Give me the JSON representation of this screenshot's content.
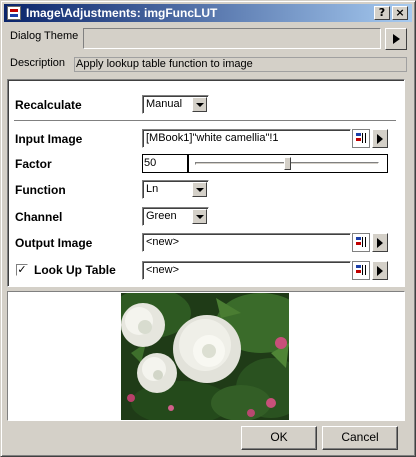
{
  "window": {
    "title": "Image\\Adjustments: imgFuncLUT",
    "help_label": "?",
    "close_label": "×"
  },
  "theme": {
    "label": "Dialog Theme",
    "value": ""
  },
  "description": {
    "label": "Description",
    "value": "Apply lookup table function to image"
  },
  "form": {
    "recalculate": {
      "label": "Recalculate",
      "value": "Manual"
    },
    "input_image": {
      "label": "Input Image",
      "value": "[MBook1]\"white camellia\"!1"
    },
    "factor": {
      "label": "Factor",
      "value": "50",
      "slider_fraction": 0.5
    },
    "function": {
      "label": "Function",
      "value": "Ln"
    },
    "channel": {
      "label": "Channel",
      "value": "Green"
    },
    "output_image": {
      "label": "Output Image",
      "value": "<new>"
    },
    "look_up_table": {
      "label": "Look Up Table",
      "checked": true,
      "check_mark": "✓",
      "value": "<new>"
    }
  },
  "preview": {
    "image_name": "white-camellia-photo"
  },
  "buttons": {
    "ok": "OK",
    "cancel": "Cancel"
  },
  "colors": {
    "titlebar_start": "#0a246a",
    "titlebar_end": "#a6caf0",
    "dialog_face": "#d4d0c8",
    "foliage": "#2e5a22",
    "flower": "#f4f4ee",
    "pink_blossom": "#c8507a"
  }
}
